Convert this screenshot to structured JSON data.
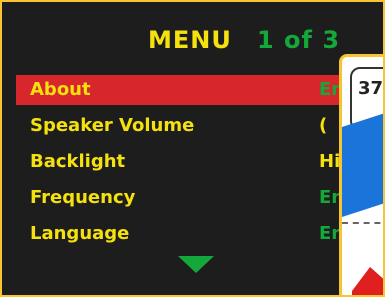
{
  "menu": {
    "title": "MENU",
    "page_indicator": "1 of 3",
    "items": [
      {
        "label": "About",
        "value": "En"
      },
      {
        "label": "Speaker Volume",
        "value": "("
      },
      {
        "label": "Backlight",
        "value": "Hi"
      },
      {
        "label": "Frequency",
        "value": "En"
      },
      {
        "label": "Language",
        "value": "Engl"
      }
    ]
  },
  "overlay": {
    "number": "37"
  },
  "colors": {
    "title": "#f5e10e",
    "value": "#14a83a",
    "selected_row": "#d7262c",
    "border": "#f7c531",
    "background": "#1d1d1d"
  }
}
